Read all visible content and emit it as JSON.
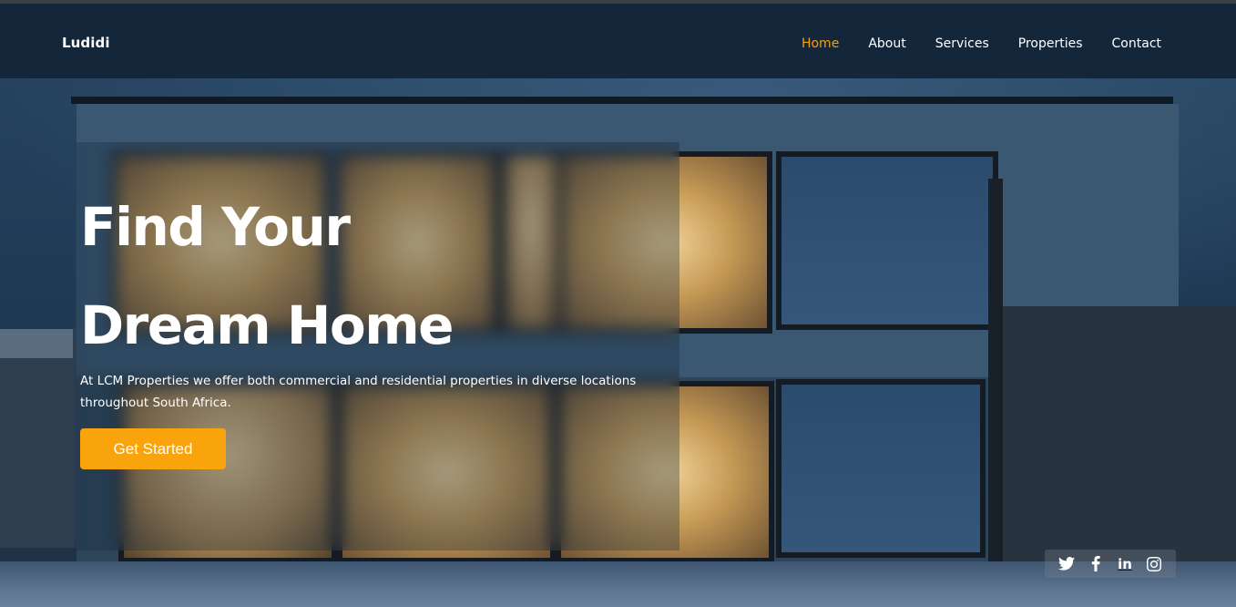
{
  "header": {
    "brand": "Ludidi",
    "nav": [
      {
        "label": "Home",
        "active": true
      },
      {
        "label": "About",
        "active": false
      },
      {
        "label": "Services",
        "active": false
      },
      {
        "label": "Properties",
        "active": false
      },
      {
        "label": "Contact",
        "active": false
      }
    ]
  },
  "hero": {
    "title_line1": "Find Your",
    "title_line2": "Dream Home",
    "subtitle": "At LCM Properties we offer both commercial and residential properties in diverse locations throughout South Africa.",
    "cta_label": "Get Started"
  },
  "social": {
    "icons": [
      "twitter-icon",
      "facebook-icon",
      "linkedin-icon",
      "instagram-icon"
    ],
    "linkedin_text": "in"
  },
  "colors": {
    "accent": "#f9a30d",
    "header_bg": "#13263a",
    "nav_active": "#f2a20c"
  }
}
